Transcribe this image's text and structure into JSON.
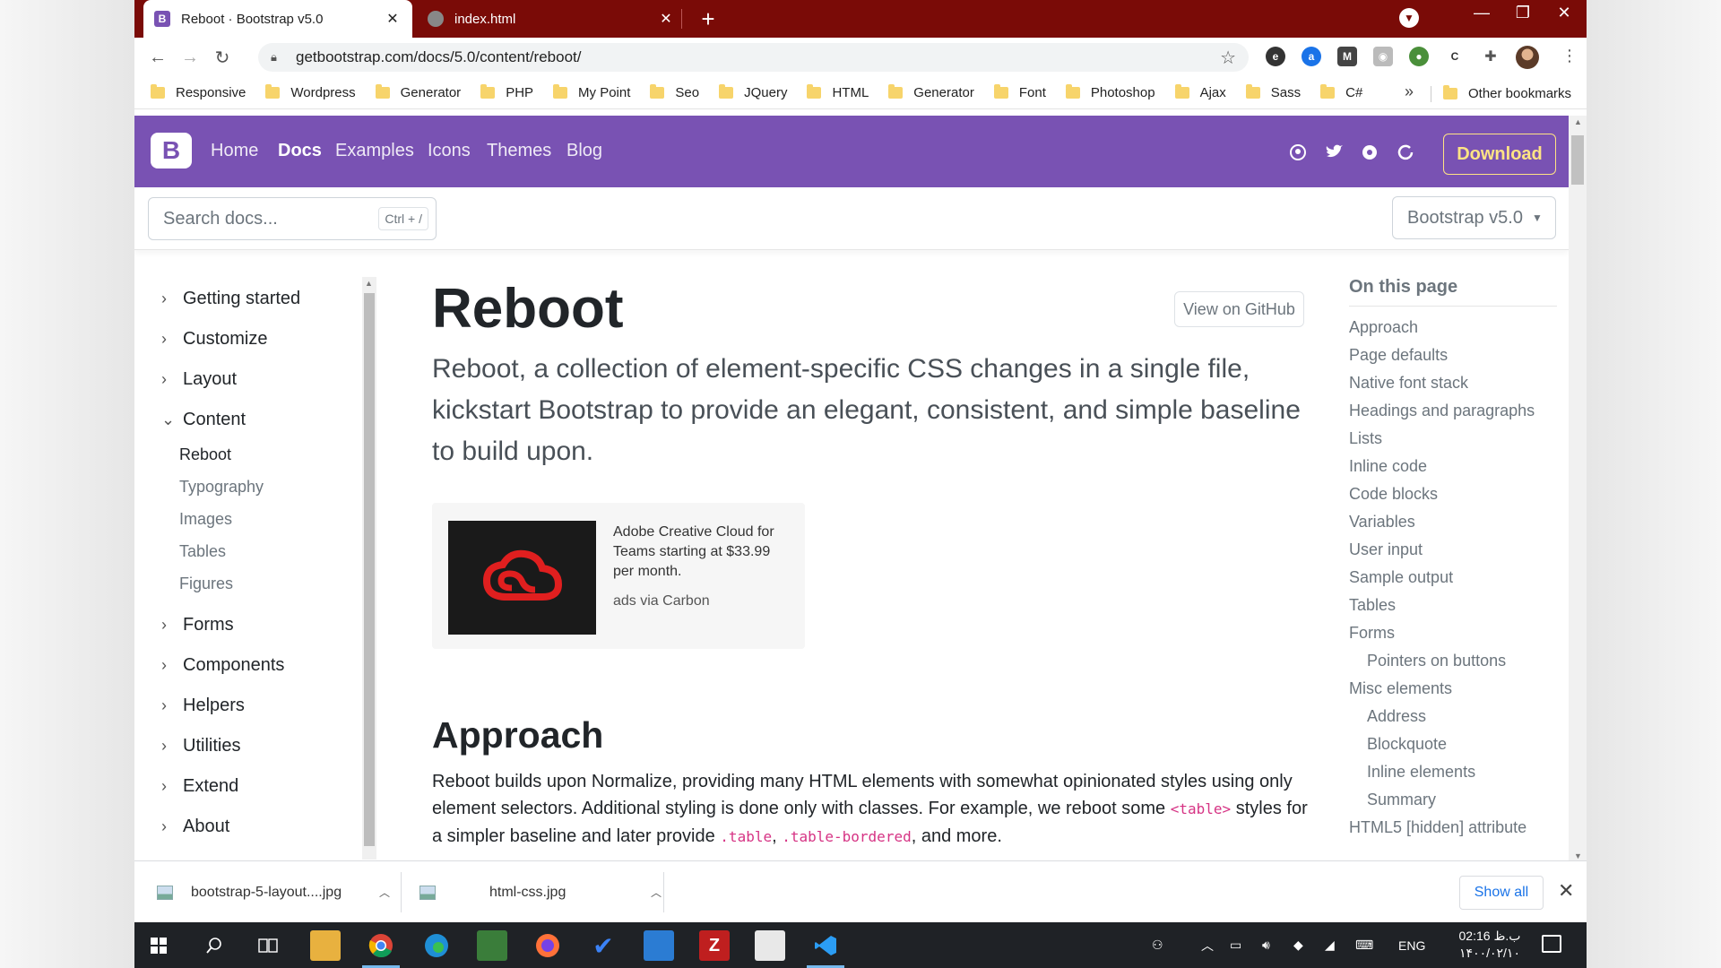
{
  "browser": {
    "tabs": [
      {
        "title": "Reboot · Bootstrap v5.0",
        "favicon": "B"
      },
      {
        "title": "index.html"
      }
    ],
    "url": "getbootstrap.com/docs/5.0/content/reboot/",
    "bookmarks": [
      "Responsive",
      "Wordpress",
      "Generator",
      "PHP",
      "My Point",
      "Seo",
      "JQuery",
      "HTML",
      "Generator",
      "Font",
      "Photoshop",
      "Ajax",
      "Sass",
      "C#"
    ],
    "other_bookmarks": "Other bookmarks",
    "more": "»",
    "titlebar_color": "#7a0b07"
  },
  "bs": {
    "brand_color": "#7952b3",
    "logo": "B",
    "nav": [
      "Home",
      "Docs",
      "Examples",
      "Icons",
      "Themes",
      "Blog"
    ],
    "download": "Download",
    "search_placeholder": "Search docs...",
    "search_kbd": "Ctrl + /",
    "version": "Bootstrap v5.0"
  },
  "sidebar": {
    "sections": [
      "Getting started",
      "Customize",
      "Layout",
      "Content",
      "Forms",
      "Components",
      "Helpers",
      "Utilities",
      "Extend",
      "About"
    ],
    "content_items": [
      "Reboot",
      "Typography",
      "Images",
      "Tables",
      "Figures"
    ],
    "active": "Reboot"
  },
  "main": {
    "title": "Reboot",
    "github_btn": "View on GitHub",
    "lead": "Reboot, a collection of element-specific CSS changes in a single file, kickstart Bootstrap to provide an elegant, consistent, and simple baseline to build upon.",
    "ad_text": "Adobe Creative Cloud for Teams starting at $33.99 per month.",
    "ad_via": "ads via Carbon",
    "h2": "Approach",
    "p1": "Reboot builds upon Normalize, providing many HTML elements with somewhat opinionated styles using only element selectors. Additional styling is done only with classes. For example, we reboot some ",
    "code1": "<table>",
    "p2": " styles for a simpler baseline and later provide ",
    "code2": ".table",
    "comma": ", ",
    "code3": ".table-bordered",
    "p3": ", and more."
  },
  "toc": {
    "title": "On this page",
    "items": [
      "Approach",
      "Page defaults",
      "Native font stack",
      "Headings and paragraphs",
      "Lists",
      "Inline code",
      "Code blocks",
      "Variables",
      "User input",
      "Sample output",
      "Tables",
      "Forms",
      "Pointers on buttons",
      "Misc elements",
      "Address",
      "Blockquote",
      "Inline elements",
      "Summary",
      "HTML5 [hidden] attribute"
    ]
  },
  "downloads": {
    "items": [
      "bootstrap-5-layout....jpg",
      "html-css.jpg"
    ],
    "show_all": "Show all"
  },
  "taskbar": {
    "lang": "ENG",
    "time": "02:16 ب.ظ",
    "date": "۱۴۰۰/۰۲/۱۰"
  }
}
